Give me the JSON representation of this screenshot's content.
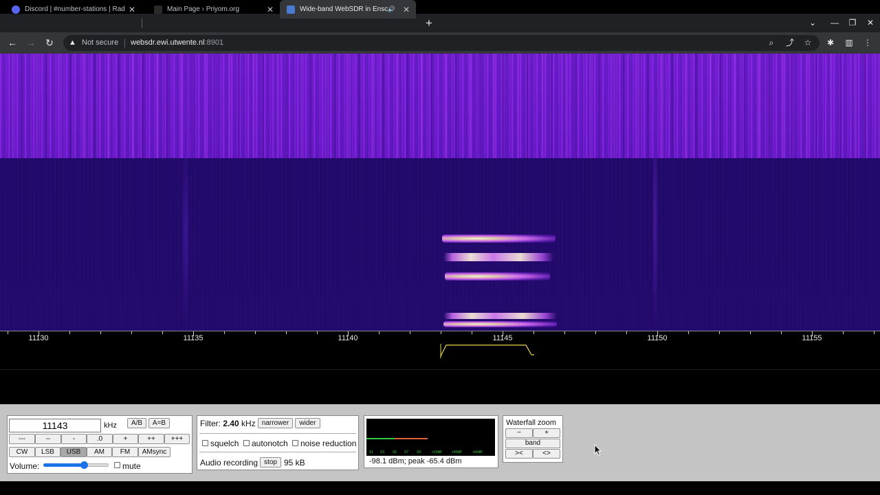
{
  "browser": {
    "tabs": [
      {
        "title": "Discord | #number-stations | Rad",
        "fav_color": "#5865f2",
        "active": false
      },
      {
        "title": "Main Page › Priyom.org",
        "fav_color": "#2a2a2a",
        "active": false
      },
      {
        "title": "Wide-band WebSDR in Ensch",
        "fav_color": "#4a7bd1",
        "active": true,
        "audio": "🔊"
      }
    ],
    "new_tab": "+",
    "tab_close": "✕",
    "window": {
      "dropdown": "⌄",
      "minimize": "—",
      "restore": "❐",
      "close": "✕"
    },
    "nav": {
      "back": "←",
      "forward": "→",
      "reload": "↻"
    },
    "address": {
      "warning_icon": "▲",
      "security": "Not secure",
      "host": "websdr.ewi.utwente.nl",
      "port": ":8901"
    },
    "toolbar_icons": {
      "zoom": "⌕",
      "share": "⤴",
      "bookmark": "☆",
      "extensions": "✱",
      "sidepanel": "▥",
      "menu": "⋮"
    }
  },
  "scale": {
    "labels": [
      "11130",
      "11135",
      "11140",
      "11145",
      "11150",
      "11155"
    ]
  },
  "frequency": {
    "value": "11143",
    "unit": "kHz",
    "ab_button": "A/B",
    "aeqb_button": "A=B",
    "step_buttons": [
      "---",
      "--",
      "-",
      ".0",
      "+",
      "++",
      "+++"
    ],
    "modes": [
      "CW",
      "LSB",
      "USB",
      "AM",
      "FM",
      "AMsync"
    ],
    "active_mode": "USB",
    "volume_label": "Volume:",
    "volume_level": 0.62,
    "mute_label": "mute"
  },
  "filter": {
    "label": "Filter:",
    "value": "2.40",
    "unit": "kHz",
    "narrower": "narrower",
    "wider": "wider",
    "squelch": "squelch",
    "autonotch": "autonotch",
    "noise_reduction": "noise reduction",
    "audio_recording": "Audio recording",
    "stop": "stop",
    "size": "95 kB"
  },
  "smeter": {
    "scale_labels": [
      "S1",
      "S3",
      "S5",
      "S7",
      "S9",
      "+20dB",
      "+40dB",
      "+60dB"
    ],
    "readout": "-98.1 dBm; peak  -65.4 dBm",
    "colors": {
      "green": "#2ecc40",
      "red": "#e0603a"
    }
  },
  "waterfall_zoom": {
    "title": "Waterfall zoom",
    "minus": "−",
    "plus": "+",
    "band": "band",
    "narrow": "><",
    "wide": "<>"
  }
}
